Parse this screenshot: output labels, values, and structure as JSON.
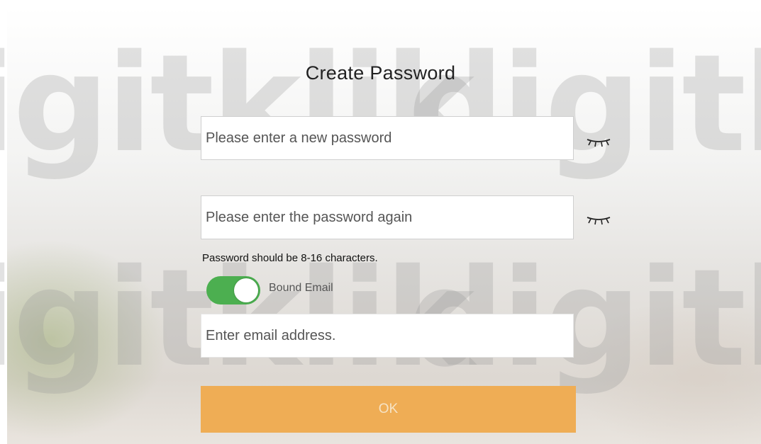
{
  "watermark": {
    "text": "digitklik"
  },
  "dialog": {
    "title": "Create Password",
    "new_password": {
      "placeholder": "Please enter a new password",
      "value": ""
    },
    "confirm_password": {
      "placeholder": "Please enter the password again",
      "value": ""
    },
    "hint": "Password should be 8-16 characters.",
    "bound_email": {
      "label": "Bound Email",
      "enabled": true
    },
    "email": {
      "placeholder": "Enter email address.",
      "value": ""
    },
    "ok_label": "OK"
  },
  "icons": {
    "password_visibility": "eye-closed-icon",
    "toggle": "toggle-switch"
  },
  "colors": {
    "accent": "#efad55",
    "toggle_on": "#4caf50",
    "watermark": "#969696"
  }
}
